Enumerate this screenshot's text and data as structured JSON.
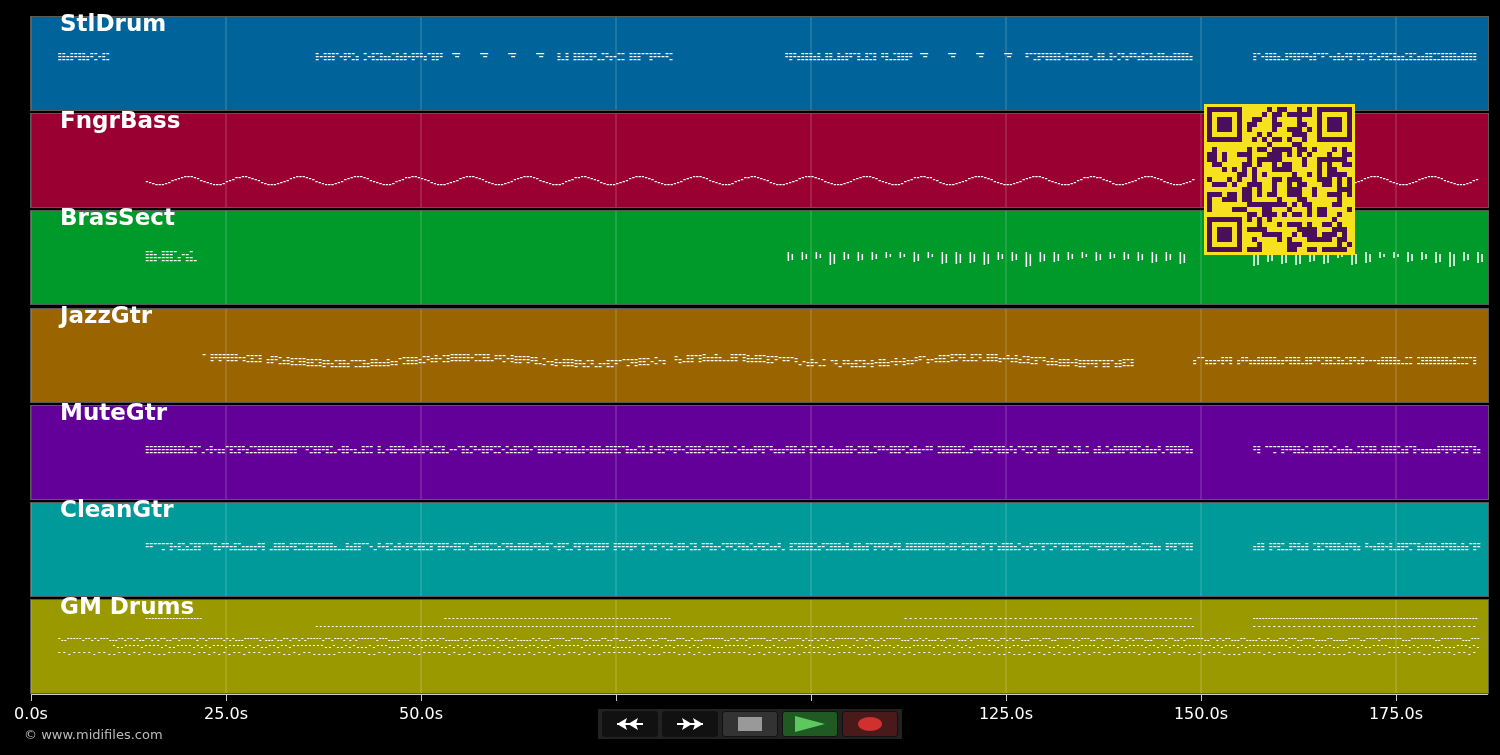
{
  "tracks": [
    {
      "name": "StlDrum",
      "color": "#00649a"
    },
    {
      "name": "FngrBass",
      "color": "#9a0032"
    },
    {
      "name": "BrasSect",
      "color": "#009a2a"
    },
    {
      "name": "JazzGtr",
      "color": "#9a6400"
    },
    {
      "name": "MuteGtr",
      "color": "#64009a"
    },
    {
      "name": "CleanGtr",
      "color": "#009a9a"
    },
    {
      "name": "GM Drums",
      "color": "#9a9a00"
    }
  ],
  "time_axis": {
    "ticks": [
      {
        "label": "0.0s"
      },
      {
        "label": "25.0s"
      },
      {
        "label": "50.0s"
      },
      {
        "hidden": true
      },
      {
        "hidden": true
      },
      {
        "label": "125.0s"
      },
      {
        "label": "150.0s"
      },
      {
        "label": "175.0s"
      }
    ]
  },
  "copyright": "© www.midifiles.com",
  "transport": [
    {
      "kind": "rewind"
    },
    {
      "kind": "forward"
    },
    {
      "kind": "stop"
    },
    {
      "kind": "play"
    },
    {
      "kind": "record"
    }
  ]
}
